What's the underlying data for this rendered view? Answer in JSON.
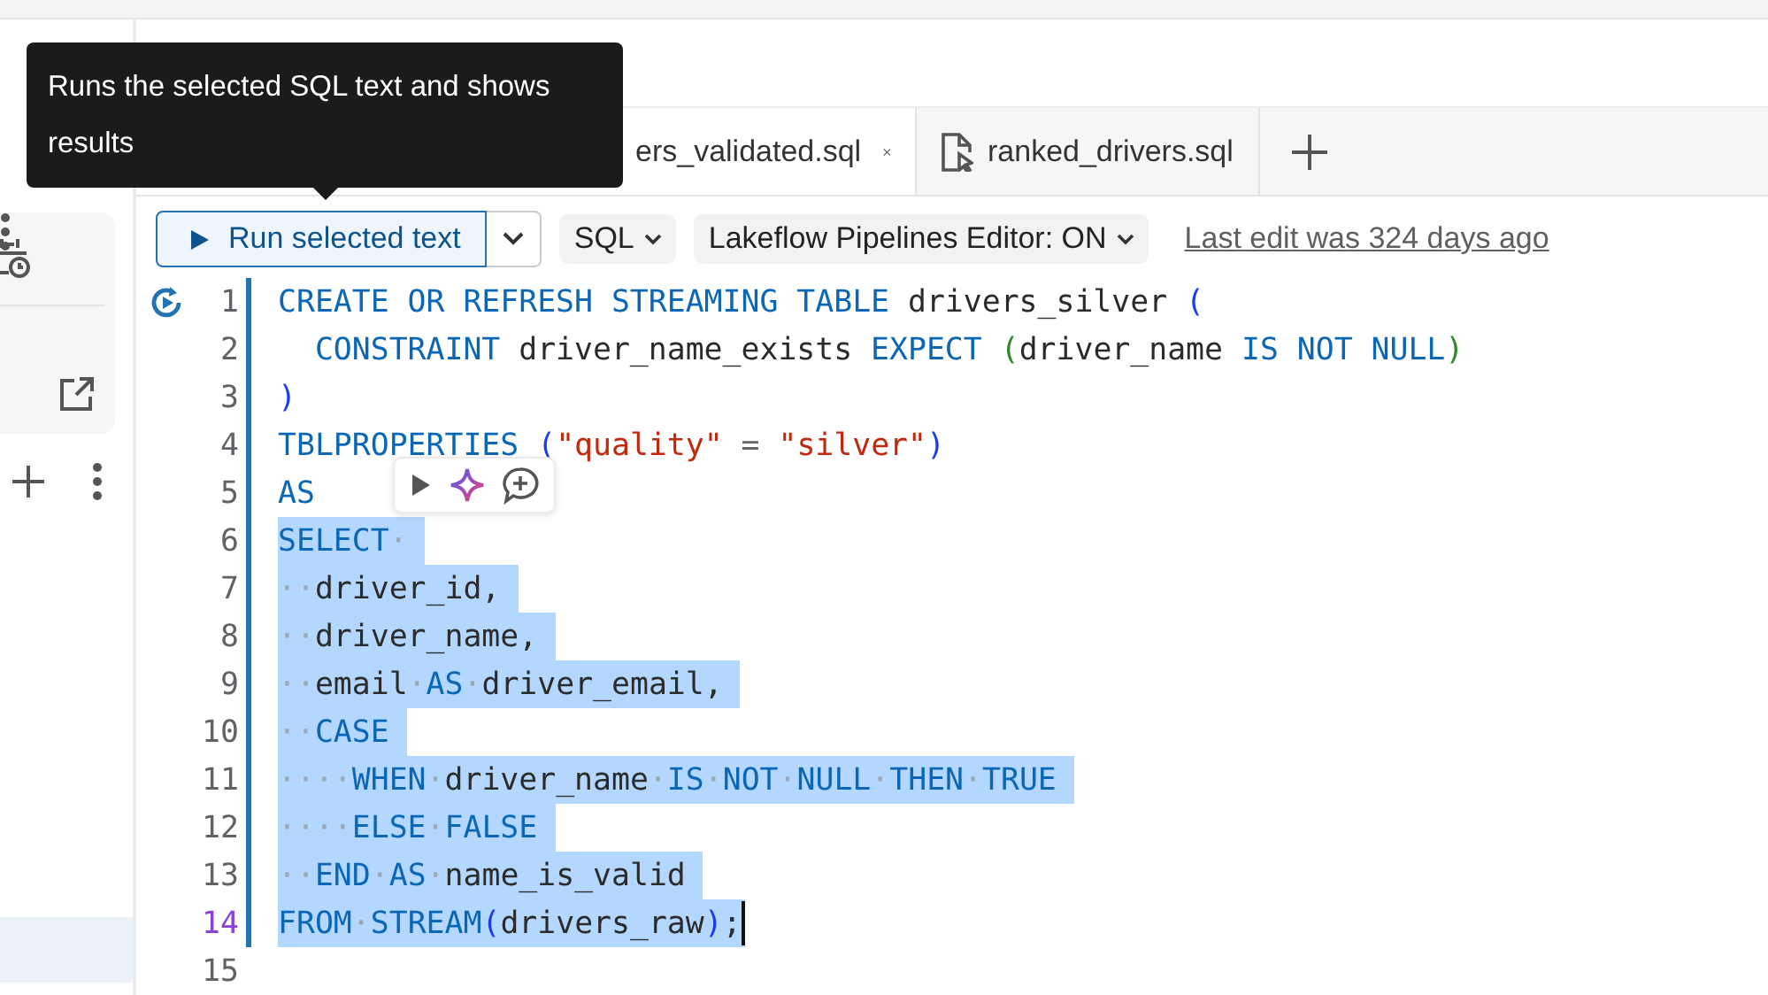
{
  "tooltip": {
    "text": "Runs the selected SQL text and shows results"
  },
  "sidebar": {
    "items": [
      {
        "selected": true
      }
    ]
  },
  "tabs": [
    {
      "label": "ers_validated.sql",
      "selected": true,
      "closable": true
    },
    {
      "label": "ranked_drivers.sql",
      "selected": false,
      "closable": false
    }
  ],
  "toolbar": {
    "run_button": "Run selected text",
    "language": "SQL",
    "editor_toggle": "Lakeflow Pipelines Editor: ON",
    "last_edit": "Last edit was 324 days ago"
  },
  "editor": {
    "lines": [
      {
        "number": "1",
        "selected": false,
        "current": false,
        "tokens": [
          {
            "kind": "keyword",
            "text": "CREATE OR REFRESH STREAMING TABLE"
          },
          {
            "kind": "ident",
            "text": " drivers_silver "
          },
          {
            "kind": "bracket",
            "text": "("
          }
        ]
      },
      {
        "number": "2",
        "selected": false,
        "current": false,
        "tokens": [
          {
            "kind": "keyword",
            "text": "  CONSTRAINT"
          },
          {
            "kind": "ident",
            "text": " driver_name_exists "
          },
          {
            "kind": "keyword",
            "text": "EXPECT "
          },
          {
            "kind": "bracket2",
            "text": "("
          },
          {
            "kind": "ident",
            "text": "driver_name "
          },
          {
            "kind": "keyword",
            "text": "IS NOT NULL"
          },
          {
            "kind": "bracket2",
            "text": ")"
          }
        ]
      },
      {
        "number": "3",
        "selected": false,
        "current": false,
        "tokens": [
          {
            "kind": "bracket",
            "text": ")"
          }
        ]
      },
      {
        "number": "4",
        "selected": false,
        "current": false,
        "tokens": [
          {
            "kind": "keyword",
            "text": "TBLPROPERTIES "
          },
          {
            "kind": "bracket",
            "text": "("
          },
          {
            "kind": "string",
            "text": "\"quality\""
          },
          {
            "kind": "punct",
            "text": " = "
          },
          {
            "kind": "string",
            "text": "\"silver\""
          },
          {
            "kind": "bracket",
            "text": ")"
          }
        ]
      },
      {
        "number": "5",
        "selected": false,
        "current": false,
        "tokens": [
          {
            "kind": "keyword",
            "text": "AS"
          }
        ]
      },
      {
        "number": "6",
        "selected": true,
        "current": false,
        "tokens": [
          {
            "kind": "keyword",
            "text": "SELECT"
          },
          {
            "kind": "ws",
            "text": "·"
          }
        ]
      },
      {
        "number": "7",
        "selected": true,
        "current": false,
        "tokens": [
          {
            "kind": "ws",
            "text": "··"
          },
          {
            "kind": "ident",
            "text": "driver_id,"
          }
        ]
      },
      {
        "number": "8",
        "selected": true,
        "current": false,
        "tokens": [
          {
            "kind": "ws",
            "text": "··"
          },
          {
            "kind": "ident",
            "text": "driver_name,"
          }
        ]
      },
      {
        "number": "9",
        "selected": true,
        "current": false,
        "tokens": [
          {
            "kind": "ws",
            "text": "··"
          },
          {
            "kind": "ident",
            "text": "email"
          },
          {
            "kind": "ws",
            "text": "·"
          },
          {
            "kind": "keyword",
            "text": "AS"
          },
          {
            "kind": "ws",
            "text": "·"
          },
          {
            "kind": "ident",
            "text": "driver_email,"
          }
        ]
      },
      {
        "number": "10",
        "selected": true,
        "current": false,
        "tokens": [
          {
            "kind": "ws",
            "text": "··"
          },
          {
            "kind": "keyword",
            "text": "CASE"
          }
        ]
      },
      {
        "number": "11",
        "selected": true,
        "current": false,
        "tokens": [
          {
            "kind": "ws",
            "text": "····"
          },
          {
            "kind": "keyword",
            "text": "WHEN"
          },
          {
            "kind": "ws",
            "text": "·"
          },
          {
            "kind": "ident",
            "text": "driver_name"
          },
          {
            "kind": "ws",
            "text": "·"
          },
          {
            "kind": "keyword",
            "text": "IS"
          },
          {
            "kind": "ws",
            "text": "·"
          },
          {
            "kind": "keyword",
            "text": "NOT"
          },
          {
            "kind": "ws",
            "text": "·"
          },
          {
            "kind": "keyword",
            "text": "NULL"
          },
          {
            "kind": "ws",
            "text": "·"
          },
          {
            "kind": "keyword",
            "text": "THEN"
          },
          {
            "kind": "ws",
            "text": "·"
          },
          {
            "kind": "keyword",
            "text": "TRUE"
          }
        ]
      },
      {
        "number": "12",
        "selected": true,
        "current": false,
        "tokens": [
          {
            "kind": "ws",
            "text": "····"
          },
          {
            "kind": "keyword",
            "text": "ELSE"
          },
          {
            "kind": "ws",
            "text": "·"
          },
          {
            "kind": "keyword",
            "text": "FALSE"
          }
        ]
      },
      {
        "number": "13",
        "selected": true,
        "current": false,
        "tokens": [
          {
            "kind": "ws",
            "text": "··"
          },
          {
            "kind": "keyword",
            "text": "END"
          },
          {
            "kind": "ws",
            "text": "·"
          },
          {
            "kind": "keyword",
            "text": "AS"
          },
          {
            "kind": "ws",
            "text": "·"
          },
          {
            "kind": "ident",
            "text": "name_is_valid"
          }
        ]
      },
      {
        "number": "14",
        "selected": true,
        "current": true,
        "tokens": [
          {
            "kind": "keyword",
            "text": "FROM"
          },
          {
            "kind": "ws",
            "text": "·"
          },
          {
            "kind": "keyword",
            "text": "STREAM"
          },
          {
            "kind": "bracket",
            "text": "("
          },
          {
            "kind": "ident",
            "text": "drivers_raw"
          },
          {
            "kind": "bracket",
            "text": ")"
          },
          {
            "kind": "ident",
            "text": ";"
          }
        ]
      },
      {
        "number": "15",
        "selected": false,
        "current": false
      }
    ]
  }
}
